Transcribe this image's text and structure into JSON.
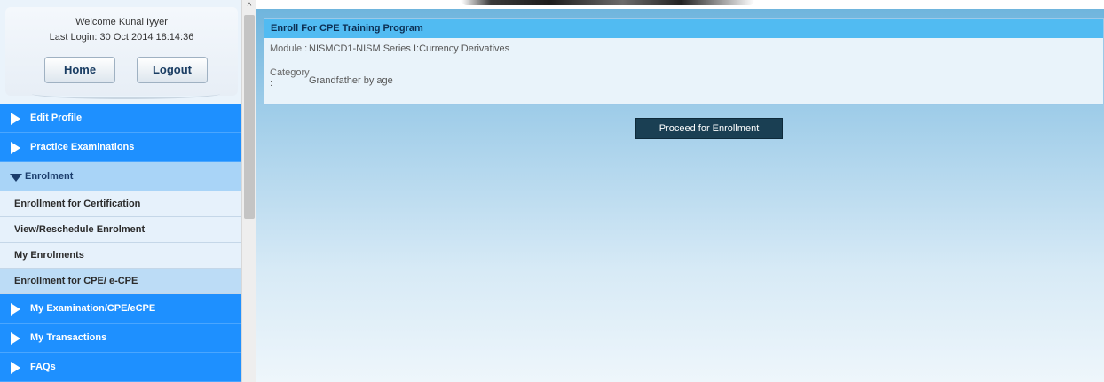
{
  "sidebar": {
    "welcome": "Welcome Kunal Iyyer",
    "last_login": "Last Login: 30 Oct 2014 18:14:36",
    "home_label": "Home",
    "logout_label": "Logout",
    "menu": [
      {
        "label": "Edit Profile"
      },
      {
        "label": "Practice Examinations"
      },
      {
        "label": "Enrolment"
      },
      {
        "label": "My Examination/CPE/eCPE"
      },
      {
        "label": "My Transactions"
      },
      {
        "label": "FAQs"
      }
    ],
    "submenu": [
      {
        "label": "Enrollment for Certification"
      },
      {
        "label": "View/Reschedule Enrolment"
      },
      {
        "label": "My Enrolments"
      },
      {
        "label": "Enrollment for CPE/ e-CPE"
      }
    ]
  },
  "panel": {
    "title": "Enroll For CPE Training Program",
    "module_label": "Module :",
    "module_value": "NISMCD1-NISM Series I:Currency Derivatives",
    "category_label": "Category :",
    "category_value": "Grandfather by age"
  },
  "proceed_label": "Proceed for Enrollment",
  "colors": {
    "menu_blue": "#1e90ff",
    "panel_header": "#51bbf2",
    "button_dark": "#1a3f53"
  }
}
